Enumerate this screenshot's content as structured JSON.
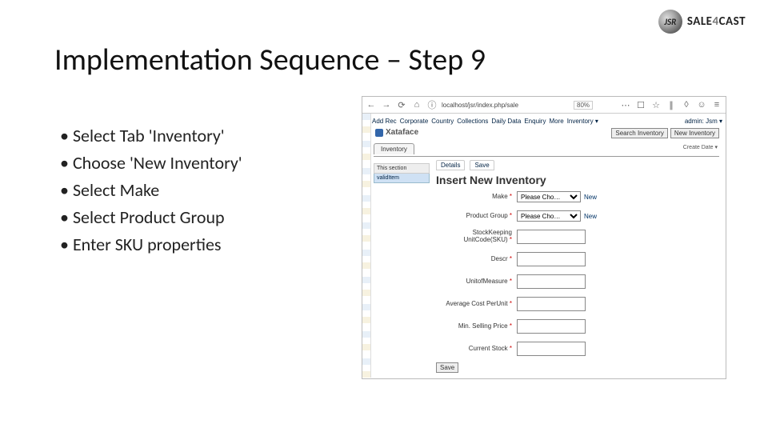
{
  "logo": {
    "ball": "JSR",
    "brand_bold": "SALE",
    "brand_grey": "4",
    "brand_rest": "CAST"
  },
  "title": "Implementation Sequence – Step 9",
  "bullets": [
    "Select Tab 'Inventory'",
    "Choose 'New Inventory'",
    "Select Make",
    "Select Product Group",
    "Enter SKU properties"
  ],
  "shot": {
    "url": "localhost/jsr/index.php/sale",
    "zoom": "80%",
    "nav": [
      "Add Rec",
      "Corporate",
      "Country",
      "Collections",
      "Daily Data",
      "Enquiry",
      "More",
      "Inventory ▾"
    ],
    "admin": "admin: Jsm ▾",
    "createdby": "Create Date ▾",
    "brand": "Xataface",
    "search_btn": "Search Inventory",
    "new_btn": "New Inventory",
    "tab": "Inventory",
    "left_hdr": "This section",
    "left_item": "validItem",
    "subtabs": [
      "Details",
      "Save"
    ],
    "form_title": "Insert New Inventory",
    "fields": {
      "make": {
        "label": "Make",
        "value": "Please Cho…",
        "link": "New"
      },
      "pg": {
        "label": "Product Group",
        "value": "Please Cho…",
        "link": "New"
      },
      "sku": "StockKeeping UnitCode(SKU)",
      "descr": "Descr",
      "uom": "UnitofMeasure",
      "cost": "Average Cost PerUnit",
      "price": "Min. Selling Price",
      "stock": "Current Stock"
    },
    "save": "Save"
  }
}
